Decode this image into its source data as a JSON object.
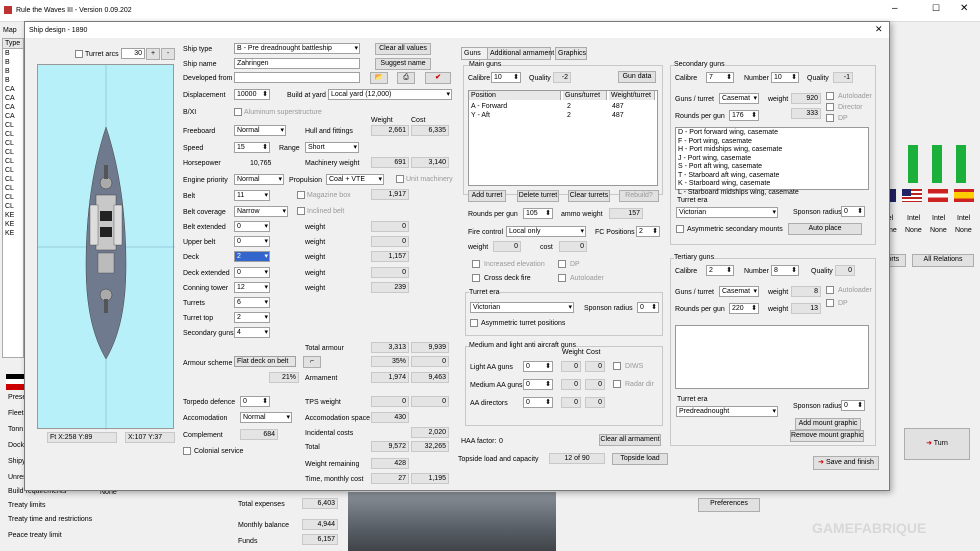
{
  "app": {
    "title": "Rule the Waves III - Version 0.09.202"
  },
  "dialog": {
    "title": "Ship design - 1890"
  },
  "left_menu": {
    "map": "Map",
    "type_header": "Type",
    "types": [
      "B",
      "B",
      "B",
      "B",
      "CA",
      "CA",
      "CA",
      "CA",
      "CL",
      "CL",
      "CL",
      "CL",
      "CL",
      "CL",
      "CL",
      "CL",
      "CL",
      "CL",
      "KE",
      "KE",
      "KE"
    ]
  },
  "left_bottom": [
    "Prese",
    "Fleet",
    "Tonn",
    "Dock",
    "Shipy",
    "Unres",
    "Build requirements",
    "Treaty limits",
    "Treaty time and restrictions",
    "Peace treaty limit"
  ],
  "bottom": {
    "none": "None",
    "total_expenses_label": "Total expenses",
    "total_expenses": "6,403",
    "monthly_balance_label": "Monthly balance",
    "monthly_balance": "4,944",
    "funds_label": "Funds",
    "funds": "6,157",
    "preferences": "Preferences",
    "watermark": "GAMEFABRIQUE"
  },
  "right": {
    "intel": [
      "Intel",
      "Intel",
      "Intel",
      "Intel"
    ],
    "none": [
      "None",
      "None",
      "None",
      "None"
    ],
    "ports": "Ports",
    "all_relations": "All Relations",
    "turn": "Turn",
    "flags": [
      "uk",
      "us",
      "at",
      "es"
    ]
  },
  "ship": {
    "turret_arcs": "Turret arcs",
    "arcs_value": "30",
    "plus": "+",
    "minus": "-",
    "coords_left": "Ft X:258 Y:89",
    "coords_right": "X:107 Y:37"
  },
  "form": {
    "ship_type_label": "Ship type",
    "ship_type": "B - Pre dreadnought battleship",
    "clear_all_values": "Clear all values",
    "ship_name_label": "Ship name",
    "ship_name": "Zahringen",
    "suggest_name": "Suggest name",
    "developed_from_label": "Developed from",
    "displacement_label": "Displacement",
    "displacement": "10000",
    "build_at_yard_label": "Build at yard",
    "build_at_yard": "Local yard (12,000)",
    "bxi_label": "B/XI",
    "aluminum": "Aluminum superstructure",
    "weight_header": "Weight",
    "cost_header": "Cost",
    "freeboard_label": "Freeboard",
    "freeboard": "Normal",
    "hull_label": "Hull and fittings",
    "hull_w": "2,661",
    "hull_c": "6,335",
    "speed_label": "Speed",
    "speed": "15",
    "range_label": "Range",
    "range": "Short",
    "horsepower_label": "Horsepower",
    "horsepower": "10,765",
    "machinery_label": "Machinery weight",
    "mach_w": "691",
    "mach_c": "3,140",
    "engine_label": "Engine priority",
    "engine": "Normal",
    "propulsion_label": "Propulsion",
    "propulsion": "Coal + VTE",
    "unit_machinery": "Unit machinery",
    "belt_label": "Belt",
    "belt": "11",
    "magazine_box": "Magazine box",
    "belt_w": "1,917",
    "belt_cov_label": "Belt coverage",
    "belt_cov": "Narrow",
    "inclined_belt": "Inclined belt",
    "belt_ext_label": "Belt extended",
    "belt_ext": "0",
    "weight_label": "weight",
    "belt_ext_w": "0",
    "upper_belt_label": "Upper belt",
    "upper_belt": "0",
    "upper_belt_w": "0",
    "deck_label": "Deck",
    "deck": "2",
    "deck_w": "1,157",
    "deck_ext_label": "Deck extended",
    "deck_ext": "0",
    "deck_ext_w": "0",
    "conning_label": "Conning tower",
    "conning": "12",
    "conning_w": "239",
    "turrets_label": "Turrets",
    "turrets": "6",
    "turret_top_label": "Turret top",
    "turret_top": "2",
    "sec_guns_label": "Secondary guns",
    "sec_guns": "4",
    "total_armour_label": "Total armour",
    "armour_w": "3,313",
    "armour_c": "9,939",
    "armour_scheme_label": "Armour scheme",
    "armour_scheme": "Flat deck on belt",
    "armour_pct1": "35%",
    "armour_pct1_c": "0",
    "armour_pct2": "21%",
    "armament_label": "Armament",
    "arm_w": "1,974",
    "arm_c": "9,463",
    "torpedo_label": "Torpedo defence",
    "torpedo": "0",
    "tps_label": "TPS weight",
    "tps_w": "0",
    "tps_c": "0",
    "accom_label": "Accomodation",
    "accom": "Normal",
    "accom_space_label": "Accomodation space",
    "accom_space": "430",
    "complement_label": "Complement",
    "complement": "684",
    "incidental_label": "Incidental costs",
    "incidental": "2,020",
    "colonial": "Colonial service",
    "total_label": "Total",
    "total_w": "9,572",
    "total_c": "32,265",
    "weight_remaining_label": "Weight remaining",
    "weight_remaining": "428",
    "time_cost_label": "Time, monthly cost",
    "time": "27",
    "monthly": "1,195"
  },
  "tabs": [
    "Guns",
    "Additional armament",
    "Graphics"
  ],
  "main_guns": {
    "title": "Main guns",
    "calibre_label": "Calibre",
    "calibre": "10",
    "quality_label": "Quality",
    "quality": "-2",
    "gun_data": "Gun data",
    "columns": [
      "Position",
      "Guns/turret",
      "Weight/turret"
    ],
    "rows": [
      {
        "position": "A - Forward",
        "guns": "2",
        "weight": "487"
      },
      {
        "position": "Y - Aft",
        "guns": "2",
        "weight": "487"
      }
    ],
    "add_turret": "Add turret",
    "delete_turret": "Delete turret",
    "clear_turrets": "Clear turrets",
    "rebuild": "Rebuild?",
    "rpg_label": "Rounds per gun",
    "rpg": "105",
    "ammo_label": "ammo weight",
    "ammo": "157",
    "fire_label": "Fire control",
    "fire": "Local only",
    "fc_pos_label": "FC Positions",
    "fc_pos": "2",
    "weight_label": "weight",
    "fc_w": "0",
    "cost_label": "cost",
    "fc_c": "0",
    "increased_elev": "Increased elevation",
    "dp": "DP",
    "cross_deck": "Cross deck fire",
    "autoloader": "Autoloader",
    "turret_era_label": "Turret era",
    "turret_era": "Victorian",
    "sponson_label": "Sponson radius",
    "sponson": "0",
    "asym": "Asymmetric turret positions"
  },
  "aa": {
    "title": "Medium and light anti aircraft guns",
    "weight_label": "Weight",
    "cost_label": "Cost",
    "light": "Light AA guns",
    "light_v": "0",
    "medium": "Medium AA guns",
    "medium_v": "0",
    "directors": "AA directors",
    "directors_v": "0",
    "zero": "0",
    "dims": "DIWS",
    "radar": "Radar dir"
  },
  "haa": {
    "factor_label": "HAA factor:",
    "factor": "0",
    "clear_all_armament": "Clear all armament"
  },
  "topside": {
    "label": "Topside load and capacity",
    "value": "12 of 90",
    "button": "Topside load"
  },
  "secondary": {
    "title": "Secondary guns",
    "calibre_label": "Calibre",
    "calibre": "7",
    "number_label": "Number",
    "number": "10",
    "quality_label": "Quality",
    "quality": "-1",
    "guns_turret_label": "Guns / turret",
    "guns_turret": "Casemat",
    "weight_label": "weight",
    "weight": "920",
    "autoloader": "Autoloader",
    "director": "Director",
    "rpg_label": "Rounds per gun",
    "rpg": "176",
    "weight2": "333",
    "dp": "DP",
    "positions": [
      "D - Port forward wing, casemate",
      "F - Port wing, casemate",
      "H - Port midships wing, casemate",
      "J - Port wing, casemate",
      "S - Port aft wing, casemate",
      "T - Starboard aft wing, casemate",
      "K - Starboard wing, casemate",
      "L - Starboard midships wing, casemate"
    ],
    "turret_era_label": "Turret era",
    "turret_era": "Victorian",
    "sponson_label": "Sponson radius",
    "sponson": "0",
    "asym": "Asymmetric secondary mounts",
    "auto_place": "Auto place"
  },
  "tertiary": {
    "title": "Tertiary guns",
    "calibre_label": "Calibre",
    "calibre": "2",
    "number_label": "Number",
    "number": "8",
    "quality_label": "Quality",
    "quality": "0",
    "guns_turret_label": "Guns / turret",
    "guns_turret": "Casemat",
    "weight_label": "weight",
    "weight": "8",
    "autoloader": "Autoloader",
    "rpg_label": "Rounds per gun",
    "rpg": "220",
    "weight2": "13",
    "dp": "DP",
    "turret_era_label": "Turret era",
    "turret_era": "Predreadnought",
    "sponson_label": "Sponson radius",
    "sponson": "0",
    "add_mount": "Add mount graphic",
    "remove_mount": "Remove mount graphic"
  },
  "save_finish": "Save and finish"
}
